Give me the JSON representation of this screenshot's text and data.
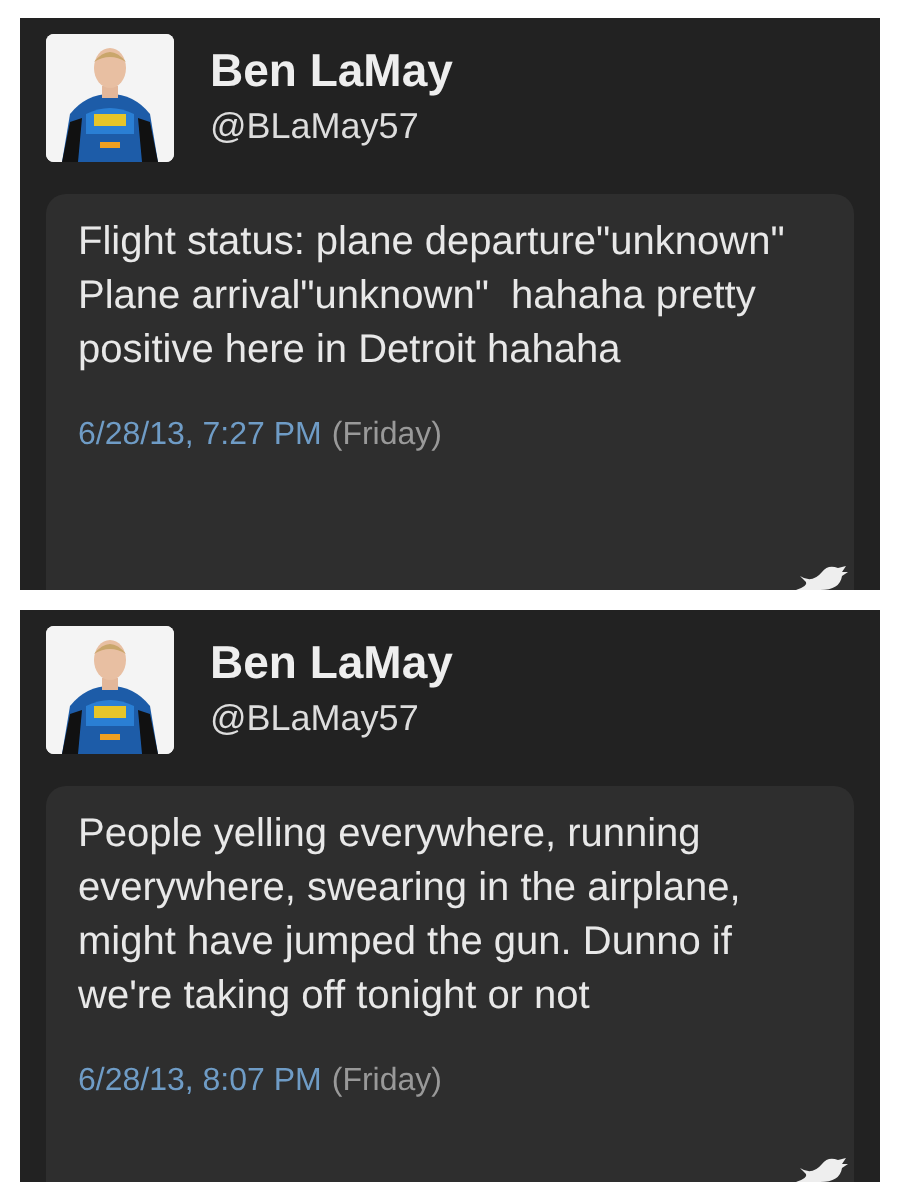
{
  "tweets": [
    {
      "name": "Ben LaMay",
      "handle": "@BLaMay57",
      "text": "Flight status: plane departure\"unknown\"\nPlane arrival\"unknown\"  hahaha pretty positive here in Detroit hahaha",
      "timestamp": "6/28/13, 7:27 PM",
      "day": "(Friday)"
    },
    {
      "name": "Ben LaMay",
      "handle": "@BLaMay57",
      "text": "People yelling everywhere, running everywhere, swearing in the airplane, might have jumped the gun. Dunno if we're taking off tonight or not",
      "timestamp": "6/28/13, 8:07 PM",
      "day": "(Friday)"
    }
  ]
}
